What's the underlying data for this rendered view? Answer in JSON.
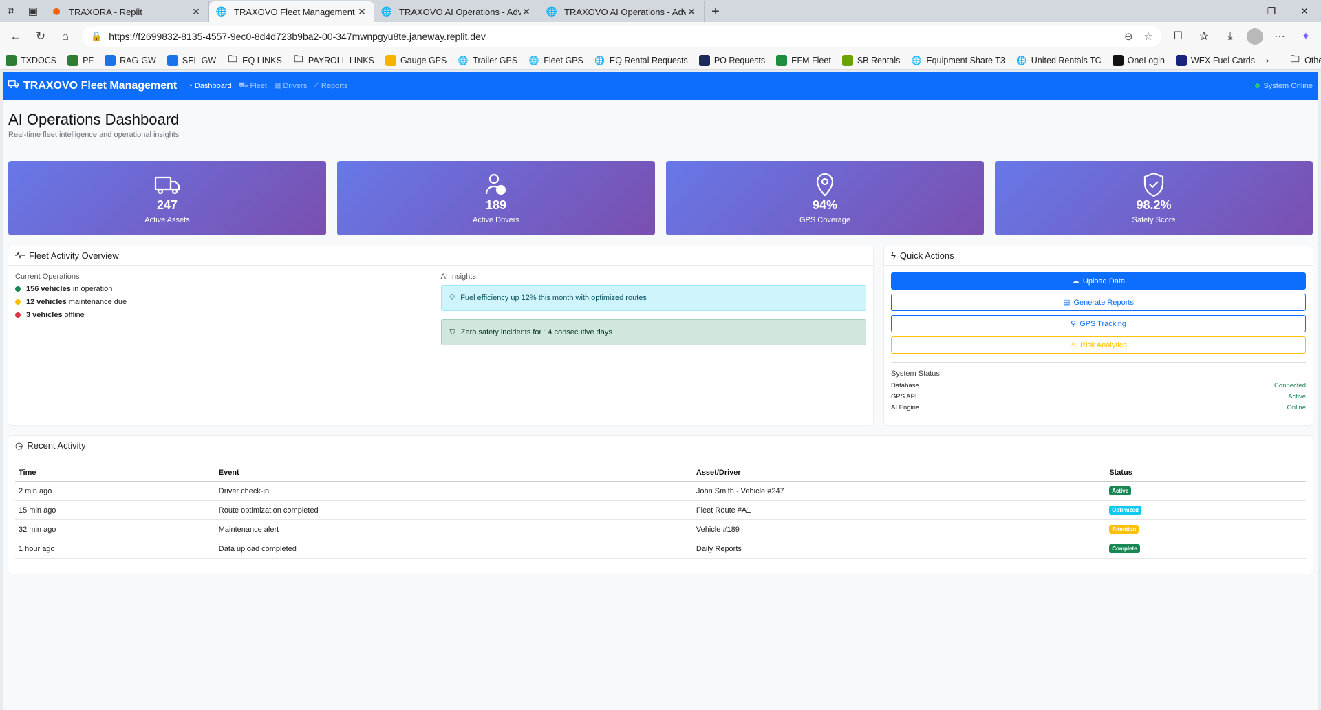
{
  "browser": {
    "tabs": [
      {
        "title": "TRAXORA - Replit",
        "active": false
      },
      {
        "title": "TRAXOVO Fleet Management - AI",
        "active": true
      },
      {
        "title": "TRAXOVO AI Operations - Advanc",
        "active": false
      },
      {
        "title": "TRAXOVO AI Operations - Advanc",
        "active": false
      }
    ],
    "url": "https://f2699832-8135-4557-9ec0-8d4d723b9ba2-00-347mwnpgyu8te.janeway.replit.dev",
    "favorites": [
      {
        "label": "TXDOCS",
        "color": "#2e7d32"
      },
      {
        "label": "PF",
        "color": "#2e7d32"
      },
      {
        "label": "RAG-GW",
        "color": "#1a73e8"
      },
      {
        "label": "SEL-GW",
        "color": "#1a73e8"
      },
      {
        "label": "EQ LINKS",
        "color": "folder"
      },
      {
        "label": "PAYROLL-LINKS",
        "color": "folder"
      },
      {
        "label": "Gauge GPS",
        "color": "#f5b400"
      },
      {
        "label": "Trailer GPS",
        "color": "globe"
      },
      {
        "label": "Fleet GPS",
        "color": "globe"
      },
      {
        "label": "EQ Rental Requests",
        "color": "globe"
      },
      {
        "label": "PO Requests",
        "color": "#1b2a5a"
      },
      {
        "label": "EFM Fleet",
        "color": "#1e8e3e"
      },
      {
        "label": "SB Rentals",
        "color": "#6aa300"
      },
      {
        "label": "Equipment Share T3",
        "color": "globe"
      },
      {
        "label": "United Rentals TC",
        "color": "globe"
      },
      {
        "label": "OneLogin",
        "color": "#111111"
      },
      {
        "label": "WEX Fuel Cards",
        "color": "#1a237e"
      }
    ],
    "other_favorites": "Other favorites"
  },
  "navbar": {
    "brand": "TRAXOVO Fleet Management",
    "links": [
      {
        "label": "Dashboard",
        "active": true,
        "icon": "dashboard-icon"
      },
      {
        "label": "Fleet",
        "active": false,
        "icon": "truck-icon"
      },
      {
        "label": "Drivers",
        "active": false,
        "icon": "id-card-icon"
      },
      {
        "label": "Reports",
        "active": false,
        "icon": "chart-icon"
      }
    ],
    "status": "System Online"
  },
  "header": {
    "title": "AI Operations Dashboard",
    "subtitle": "Real-time fleet intelligence and operational insights"
  },
  "stats": [
    {
      "value": "247",
      "label": "Active Assets",
      "icon": "truck-icon"
    },
    {
      "value": "189",
      "label": "Active Drivers",
      "icon": "user-check-icon"
    },
    {
      "value": "94%",
      "label": "GPS Coverage",
      "icon": "map-pin-icon"
    },
    {
      "value": "98.2%",
      "label": "Safety Score",
      "icon": "shield-check-icon"
    }
  ],
  "fleet_activity": {
    "title": "Fleet Activity Overview",
    "current_ops_title": "Current Operations",
    "ops": [
      {
        "count": "156 vehicles",
        "text": "in operation",
        "color": "#198754"
      },
      {
        "count": "12 vehicles",
        "text": "maintenance due",
        "color": "#ffc107"
      },
      {
        "count": "3 vehicles",
        "text": "offline",
        "color": "#dc3545"
      }
    ],
    "insights_title": "AI Insights",
    "insights": [
      {
        "text": "Fuel efficiency up 12% this month with optimized routes",
        "kind": "info",
        "icon": "lightbulb-icon"
      },
      {
        "text": "Zero safety incidents for 14 consecutive days",
        "kind": "success",
        "icon": "shield-icon"
      }
    ]
  },
  "quick_actions": {
    "title": "Quick Actions",
    "buttons": [
      {
        "label": "Upload Data",
        "style": "primary",
        "icon": "cloud-upload-icon"
      },
      {
        "label": "Generate Reports",
        "style": "outline-primary",
        "icon": "document-icon"
      },
      {
        "label": "GPS Tracking",
        "style": "outline-primary",
        "icon": "map-pin-icon"
      },
      {
        "label": "Risk Analytics",
        "style": "outline-warning",
        "icon": "warning-icon"
      }
    ],
    "system_status_title": "System Status",
    "system_status": [
      {
        "name": "Database",
        "value": "Connected"
      },
      {
        "name": "GPS API",
        "value": "Active"
      },
      {
        "name": "AI Engine",
        "value": "Online"
      }
    ]
  },
  "recent_activity": {
    "title": "Recent Activity",
    "columns": [
      "Time",
      "Event",
      "Asset/Driver",
      "Status"
    ],
    "rows": [
      {
        "time": "2 min ago",
        "event": "Driver check-in",
        "asset": "John Smith - Vehicle #247",
        "status": "Active",
        "kind": "active"
      },
      {
        "time": "15 min ago",
        "event": "Route optimization completed",
        "asset": "Fleet Route #A1",
        "status": "Optimized",
        "kind": "optimized"
      },
      {
        "time": "32 min ago",
        "event": "Maintenance alert",
        "asset": "Vehicle #189",
        "status": "Attention",
        "kind": "attention"
      },
      {
        "time": "1 hour ago",
        "event": "Data upload completed",
        "asset": "Daily Reports",
        "status": "Complete",
        "kind": "complete"
      }
    ]
  }
}
